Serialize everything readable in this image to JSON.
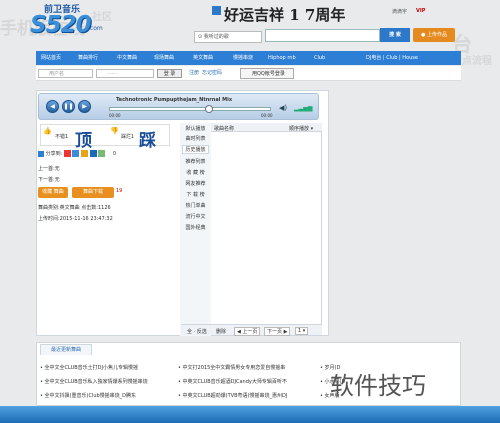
{
  "background_words": [
    "手机版在线",
    "社区",
    "点",
    "台",
    "点流程"
  ],
  "logo": {
    "brand": "前卫音乐",
    "main": "S520",
    "suffix": ".com"
  },
  "banner": {
    "text": "好运吉祥 1 7周年"
  },
  "top": {
    "ddy": "滴滴宇",
    "vip": "VIP"
  },
  "search": {
    "history_label": "我听过的歌",
    "button": "搜 索",
    "upload": "上传作品"
  },
  "nav": {
    "items": [
      "网站首页",
      "舞曲排行",
      "中文舞曲",
      "现场舞曲",
      "英文舞曲",
      "慢摇串烧",
      "Hiphop rnb",
      "Club"
    ],
    "right": "DJ电台 | Club | House"
  },
  "login": {
    "user_placeholder": "用户名",
    "password_placeholder": "·······",
    "login_btn": "登 录",
    "register": "注册",
    "forgot": "忘记密码",
    "qq": "用QQ帐号登录"
  },
  "player": {
    "title": "Technotronic Pumpupthejam_Ntnrnal Mix",
    "time_left": "00:00",
    "time_right": "00:00"
  },
  "vote": {
    "up_count": "不错1",
    "up_big": "顶",
    "down_count": "踩烂1",
    "down_big": "踩"
  },
  "share": {
    "label": "分享到:",
    "count": "0"
  },
  "song": {
    "prev": "上一首:无",
    "next": "下一首:无",
    "collect": "收藏 舞曲",
    "download": "舞曲下载",
    "dl_count": "19",
    "category": "舞曲类别:英文舞曲  点击数:1126",
    "upload_time": "上传时间:2015-11-16 23:47:32"
  },
  "sidebar": {
    "items": [
      "默认播放",
      "曲时列表",
      "历史播放",
      "推荐列表",
      "收 藏 榜",
      "网友推荐",
      "下 载 榜",
      "热门单曲",
      "流行中文",
      "国外经典"
    ]
  },
  "playlist": {
    "col_name": "歌曲名称",
    "sort": "顺序播放",
    "footer": [
      "全 · 反选",
      "删除",
      "◀ 上一页",
      "下一页 ▶",
      "1"
    ]
  },
  "latest": {
    "tab": "最近更新舞曲",
    "rows": [
      [
        "全中文全CLUB音乐土打DJ小焦儿专辑慢摇",
        "中文打2015全中文霸情男女专用恋爱自慢摇串",
        "岁月(D"
      ],
      [
        "全中文全CLUB音乐私入独家情爆系列慢摇串烧",
        "中英文CLUB音乐超酒DJCandy大师专辑百听不",
        "小水果(D"
      ],
      [
        "全中文抖飘(重音乐)Club慢摇串烧_D腾东",
        "中英文CLUB超劲爆(TVB粤语)慢摇串烧_惠州DJ",
        "女声版"
      ]
    ]
  },
  "watermark": "软件技巧"
}
